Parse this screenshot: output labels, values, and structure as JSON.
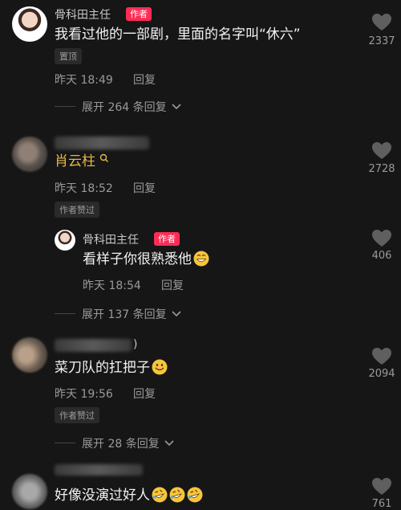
{
  "comments": [
    {
      "author": "骨科田主任",
      "badge": "作者",
      "text": "我看过他的一部剧，里面的名字叫“休六”",
      "pinned": "置顶",
      "time": "昨天 18:49",
      "reply": "回复",
      "likes": "2337",
      "expand": "展开 264 条回复"
    },
    {
      "mention": "肖云柱",
      "time": "昨天 18:52",
      "reply": "回复",
      "likes": "2728",
      "liked_by_author": "作者赞过"
    },
    {
      "author": "骨科田主任",
      "badge": "作者",
      "text": "看样子你很熟悉他",
      "time": "昨天 18:54",
      "reply": "回复",
      "likes": "406",
      "expand": "展开 137 条回复"
    },
    {
      "name_suffix": ")",
      "text": "菜刀队的扛把子",
      "time": "昨天 19:56",
      "reply": "回复",
      "likes": "2094",
      "liked_by_author": "作者赞过",
      "expand": "展开 28 条回复"
    },
    {
      "text": "好像没演过好人",
      "likes": "761"
    }
  ],
  "icons": {
    "like": "heart-outline-icon",
    "expand": "chevron-down-icon",
    "search": "search-icon",
    "emoji_grin": "grinning-emoji",
    "emoji_smile": "smiling-emoji",
    "emoji_rofl": "rolling-laughing-emoji"
  },
  "colors": {
    "background": "#161616",
    "badge": "#fe2c55",
    "mention": "#e8b64a"
  }
}
